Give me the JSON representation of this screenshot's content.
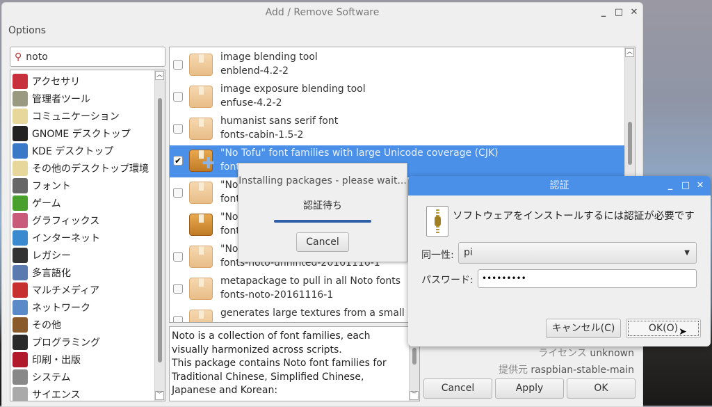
{
  "window": {
    "title": "Add / Remove Software",
    "menu": "Options"
  },
  "search": {
    "value": "noto"
  },
  "categories": [
    {
      "label": "アクセサリ",
      "icon": "accessories-icon",
      "color": "#c8303c"
    },
    {
      "label": "管理者ツール",
      "icon": "admin-tools-icon",
      "color": "#9a9a80"
    },
    {
      "label": "コミュニケーション",
      "icon": "communication-icon",
      "color": "#e8d79a"
    },
    {
      "label": "GNOME デスクトップ",
      "icon": "gnome-icon",
      "color": "#222222"
    },
    {
      "label": "KDE デスクトップ",
      "icon": "kde-icon",
      "color": "#3a78c8"
    },
    {
      "label": "その他のデスクトップ環境",
      "icon": "desktop-icon",
      "color": "#e8d79a"
    },
    {
      "label": "フォント",
      "icon": "font-icon",
      "color": "#666666"
    },
    {
      "label": "ゲーム",
      "icon": "game-icon",
      "color": "#4aa02c"
    },
    {
      "label": "グラフィックス",
      "icon": "graphics-icon",
      "color": "#c85a7a"
    },
    {
      "label": "インターネット",
      "icon": "internet-icon",
      "color": "#3a8ad0"
    },
    {
      "label": "レガシー",
      "icon": "legacy-icon",
      "color": "#333333"
    },
    {
      "label": "多言語化",
      "icon": "localization-icon",
      "color": "#5a7ab0"
    },
    {
      "label": "マルチメディア",
      "icon": "multimedia-icon",
      "color": "#c83030"
    },
    {
      "label": "ネットワーク",
      "icon": "network-icon",
      "color": "#5a8ac8"
    },
    {
      "label": "その他",
      "icon": "other-icon",
      "color": "#8a5a2a"
    },
    {
      "label": "プログラミング",
      "icon": "programming-icon",
      "color": "#2a2a2a"
    },
    {
      "label": "印刷・出版",
      "icon": "publishing-icon",
      "color": "#b01a2a"
    },
    {
      "label": "システム",
      "icon": "system-icon",
      "color": "#888888"
    },
    {
      "label": "サイエンス",
      "icon": "science-icon",
      "color": "#aaaaaa"
    }
  ],
  "packages": [
    {
      "desc": "image blending tool",
      "name": "enblend-4.2-2",
      "checked": false,
      "state": "available"
    },
    {
      "desc": "image exposure blending tool",
      "name": "enfuse-4.2-2",
      "checked": false,
      "state": "available"
    },
    {
      "desc": "humanist sans serif font",
      "name": "fonts-cabin-1.5-2",
      "checked": false,
      "state": "available"
    },
    {
      "desc": "\"No Tofu\" font families with large Unicode coverage (CJK)",
      "name": "font",
      "checked": true,
      "state": "install"
    },
    {
      "desc": "\"No",
      "name": "font",
      "checked": false,
      "state": "available"
    },
    {
      "desc": "\"No",
      "name": "font",
      "checked": false,
      "state": "installed"
    },
    {
      "desc": "\"No",
      "name": "fonts-noto-unhinted-20161116-1",
      "checked": false,
      "state": "available"
    },
    {
      "desc": "metapackage to pull in all Noto fonts",
      "name": "fonts-noto-20161116-1",
      "checked": false,
      "state": "available"
    },
    {
      "desc": "generates large textures from a small sam",
      "name": "",
      "checked": false,
      "state": "available"
    }
  ],
  "description": "Noto is a collection of font families, each visually harmonized across scripts.\nThis package contains Noto font families for Traditional Chinese, Simplified Chinese, Japanese and Korean:",
  "details": [
    {
      "label": "ライセンス",
      "value": "unknown"
    },
    {
      "label": "提供元",
      "value": "raspbian-stable-main"
    }
  ],
  "buttons": {
    "cancel": "Cancel",
    "apply": "Apply",
    "ok": "OK"
  },
  "installing": {
    "message": "Installing packages - please wait...",
    "status": "認証待ち",
    "progress": 1.0,
    "cancel": "Cancel"
  },
  "auth": {
    "title": "認証",
    "message": "ソフトウェアをインストールするには認証が必要です",
    "identity_label": "同一性:",
    "identity_value": "pi",
    "password_label": "パスワード:",
    "password_value": "•••••••••",
    "cancel": "キャンセル(C)",
    "ok": "OK(O)"
  }
}
